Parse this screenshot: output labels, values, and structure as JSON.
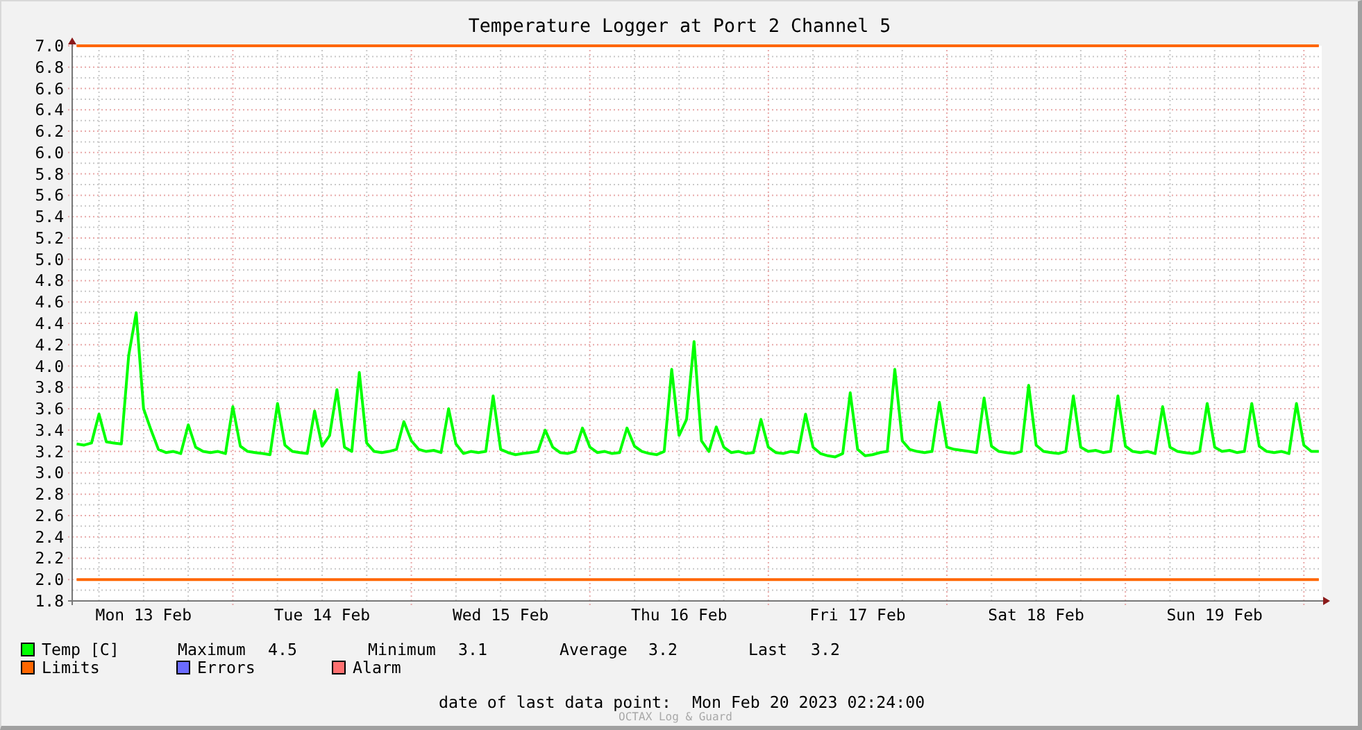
{
  "title": "Temperature Logger at Port 2 Channel 5",
  "chart_data": {
    "type": "line",
    "ylim": [
      1.8,
      7.0
    ],
    "categories": [
      null,
      null,
      null,
      null,
      null,
      null,
      null,
      null,
      null,
      "Mon 13 Feb",
      null,
      null,
      null,
      null,
      null,
      null,
      null,
      null,
      null,
      null,
      null,
      null,
      null,
      null,
      null,
      null,
      null,
      null,
      null,
      null,
      null,
      null,
      null,
      "Tue 14 Feb",
      null,
      null,
      null,
      null,
      null,
      null,
      null,
      null,
      null,
      null,
      null,
      null,
      null,
      null,
      null,
      null,
      null,
      null,
      null,
      null,
      null,
      null,
      null,
      "Wed 15 Feb",
      null,
      null,
      null,
      null,
      null,
      null,
      null,
      null,
      null,
      null,
      null,
      null,
      null,
      null,
      null,
      null,
      null,
      null,
      null,
      null,
      null,
      null,
      null,
      "Thu 16 Feb",
      null,
      null,
      null,
      null,
      null,
      null,
      null,
      null,
      null,
      null,
      null,
      null,
      null,
      null,
      null,
      null,
      null,
      null,
      null,
      null,
      null,
      null,
      null,
      "Fri 17 Feb",
      null,
      null,
      null,
      null,
      null,
      null,
      null,
      null,
      null,
      null,
      null,
      null,
      null,
      null,
      null,
      null,
      null,
      null,
      null,
      null,
      null,
      null,
      null,
      "Sat 18 Feb",
      null,
      null,
      null,
      null,
      null,
      null,
      null,
      null,
      null,
      null,
      null,
      null,
      null,
      null,
      null,
      null,
      null,
      null,
      null,
      null,
      null,
      null,
      null,
      "Sun 19 Feb",
      null,
      null,
      null,
      null,
      null,
      null,
      null,
      null,
      null,
      null,
      null,
      null,
      null,
      null
    ],
    "yticks": [
      {
        "value": 1.8,
        "label": "1.8"
      },
      {
        "value": 2.0,
        "label": "2.0"
      },
      {
        "value": 2.2,
        "label": "2.2"
      },
      {
        "value": 2.4,
        "label": "2.4"
      },
      {
        "value": 2.6,
        "label": "2.6"
      },
      {
        "value": 2.8,
        "label": "2.8"
      },
      {
        "value": 3.0,
        "label": "3.0"
      },
      {
        "value": 3.2,
        "label": "3.2"
      },
      {
        "value": 3.4,
        "label": "3.4"
      },
      {
        "value": 3.6,
        "label": "3.6"
      },
      {
        "value": 3.8,
        "label": "3.8"
      },
      {
        "value": 4.0,
        "label": "4.0"
      },
      {
        "value": 4.2,
        "label": "4.2"
      },
      {
        "value": 4.4,
        "label": "4.4"
      },
      {
        "value": 4.6,
        "label": "4.6"
      },
      {
        "value": 4.8,
        "label": "4.8"
      },
      {
        "value": 5.0,
        "label": "5.0"
      },
      {
        "value": 5.2,
        "label": "5.2"
      },
      {
        "value": 5.4,
        "label": "5.4"
      },
      {
        "value": 5.6,
        "label": "5.6"
      },
      {
        "value": 5.8,
        "label": "5.8"
      },
      {
        "value": 6.0,
        "label": "6.0"
      },
      {
        "value": 6.2,
        "label": "6.2"
      },
      {
        "value": 6.4,
        "label": "6.4"
      },
      {
        "value": 6.6,
        "label": "6.6"
      },
      {
        "value": 6.8,
        "label": "6.8"
      },
      {
        "value": 7.0,
        "label": "7.0"
      }
    ],
    "series": [
      {
        "name": "Temp [C]",
        "color": "#00ff00",
        "values": [
          3.27,
          3.26,
          3.28,
          3.55,
          3.29,
          3.28,
          3.27,
          4.1,
          4.5,
          3.6,
          3.4,
          3.22,
          3.19,
          3.2,
          3.18,
          3.45,
          3.24,
          3.2,
          3.19,
          3.2,
          3.18,
          3.62,
          3.25,
          3.2,
          3.19,
          3.18,
          3.17,
          3.65,
          3.26,
          3.2,
          3.19,
          3.18,
          3.58,
          3.25,
          3.35,
          3.78,
          3.24,
          3.2,
          3.94,
          3.28,
          3.2,
          3.19,
          3.2,
          3.22,
          3.48,
          3.3,
          3.22,
          3.2,
          3.21,
          3.19,
          3.6,
          3.27,
          3.18,
          3.2,
          3.19,
          3.2,
          3.72,
          3.22,
          3.19,
          3.17,
          3.18,
          3.19,
          3.2,
          3.4,
          3.24,
          3.19,
          3.18,
          3.2,
          3.42,
          3.24,
          3.19,
          3.2,
          3.18,
          3.19,
          3.42,
          3.25,
          3.2,
          3.18,
          3.17,
          3.2,
          3.97,
          3.35,
          3.5,
          4.23,
          3.3,
          3.2,
          3.43,
          3.24,
          3.19,
          3.2,
          3.18,
          3.19,
          3.5,
          3.24,
          3.19,
          3.18,
          3.2,
          3.19,
          3.55,
          3.24,
          3.18,
          3.16,
          3.15,
          3.18,
          3.75,
          3.22,
          3.16,
          3.17,
          3.19,
          3.2,
          3.97,
          3.3,
          3.22,
          3.2,
          3.19,
          3.2,
          3.66,
          3.24,
          3.22,
          3.21,
          3.2,
          3.19,
          3.7,
          3.25,
          3.2,
          3.19,
          3.18,
          3.2,
          3.82,
          3.26,
          3.2,
          3.19,
          3.18,
          3.2,
          3.72,
          3.24,
          3.2,
          3.21,
          3.19,
          3.2,
          3.72,
          3.25,
          3.2,
          3.19,
          3.2,
          3.18,
          3.62,
          3.24,
          3.2,
          3.19,
          3.18,
          3.2,
          3.65,
          3.24,
          3.2,
          3.21,
          3.19,
          3.2,
          3.65,
          3.25,
          3.2,
          3.19,
          3.2,
          3.18,
          3.65,
          3.26,
          3.2,
          3.2
        ]
      },
      {
        "name": "Limits",
        "color": "#ff6600",
        "values": [
          7,
          7,
          7,
          7,
          7,
          7,
          7,
          7,
          7,
          7,
          7,
          7,
          7,
          7,
          7,
          7,
          7,
          7,
          7,
          7,
          7,
          7,
          7,
          7,
          7,
          7,
          7,
          7,
          7,
          7,
          7,
          7,
          7,
          7,
          7,
          7,
          7,
          7,
          7,
          7,
          7,
          7,
          7,
          7,
          7,
          7,
          7,
          7,
          7,
          7,
          7,
          7,
          7,
          7,
          7,
          7,
          7,
          7,
          7,
          7,
          7,
          7,
          7,
          7,
          7,
          7,
          7,
          7,
          7,
          7,
          7,
          7,
          7,
          7,
          7,
          7,
          7,
          7,
          7,
          7,
          7,
          7,
          7,
          7,
          7,
          7,
          7,
          7,
          7,
          7,
          7,
          7,
          7,
          7,
          7,
          7,
          7,
          7,
          7,
          7,
          7,
          7,
          7,
          7,
          7,
          7,
          7,
          7,
          7,
          7,
          7,
          7,
          7,
          7,
          7,
          7,
          7,
          7,
          7,
          7,
          7,
          7,
          7,
          7,
          7,
          7,
          7,
          7,
          7,
          7,
          7,
          7,
          7,
          7,
          7,
          7,
          7,
          7,
          7,
          7,
          7,
          7,
          7,
          7,
          7,
          7,
          7,
          7,
          7,
          7,
          7,
          7,
          7,
          7,
          7,
          7,
          7,
          7,
          7,
          7,
          7,
          7,
          7,
          7,
          7,
          7,
          7,
          7
        ]
      },
      {
        "color": "#ff6600",
        "values": [
          2,
          2,
          2,
          2,
          2,
          2,
          2,
          2,
          2,
          2,
          2,
          2,
          2,
          2,
          2,
          2,
          2,
          2,
          2,
          2,
          2,
          2,
          2,
          2,
          2,
          2,
          2,
          2,
          2,
          2,
          2,
          2,
          2,
          2,
          2,
          2,
          2,
          2,
          2,
          2,
          2,
          2,
          2,
          2,
          2,
          2,
          2,
          2,
          2,
          2,
          2,
          2,
          2,
          2,
          2,
          2,
          2,
          2,
          2,
          2,
          2,
          2,
          2,
          2,
          2,
          2,
          2,
          2,
          2,
          2,
          2,
          2,
          2,
          2,
          2,
          2,
          2,
          2,
          2,
          2,
          2,
          2,
          2,
          2,
          2,
          2,
          2,
          2,
          2,
          2,
          2,
          2,
          2,
          2,
          2,
          2,
          2,
          2,
          2,
          2,
          2,
          2,
          2,
          2,
          2,
          2,
          2,
          2,
          2,
          2,
          2,
          2,
          2,
          2,
          2,
          2,
          2,
          2,
          2,
          2,
          2,
          2,
          2,
          2,
          2,
          2,
          2,
          2,
          2,
          2,
          2,
          2,
          2,
          2,
          2,
          2,
          2,
          2,
          2,
          2,
          2,
          2,
          2,
          2,
          2,
          2,
          2,
          2,
          2,
          2,
          2,
          2,
          2,
          2,
          2,
          2,
          2,
          2,
          2,
          2,
          2,
          2,
          2,
          2,
          2,
          2,
          2,
          2
        ]
      }
    ],
    "grid": true
  },
  "legend": [
    {
      "label": "Errors",
      "color": "#6b6bff"
    },
    {
      "label": "Alarm",
      "color": "#ff7070"
    }
  ],
  "stats": [
    {
      "label": "Maximum",
      "value": "4.5"
    },
    {
      "label": "Minimum",
      "value": "3.1"
    },
    {
      "label": "Average",
      "value": "3.2"
    },
    {
      "label": "Last",
      "value": "3.2"
    }
  ],
  "last_data_point": {
    "label": "date of last data point:",
    "value": "Mon Feb 20 2023 02:24:00"
  },
  "watermark": "OCTAX Log & Guard"
}
